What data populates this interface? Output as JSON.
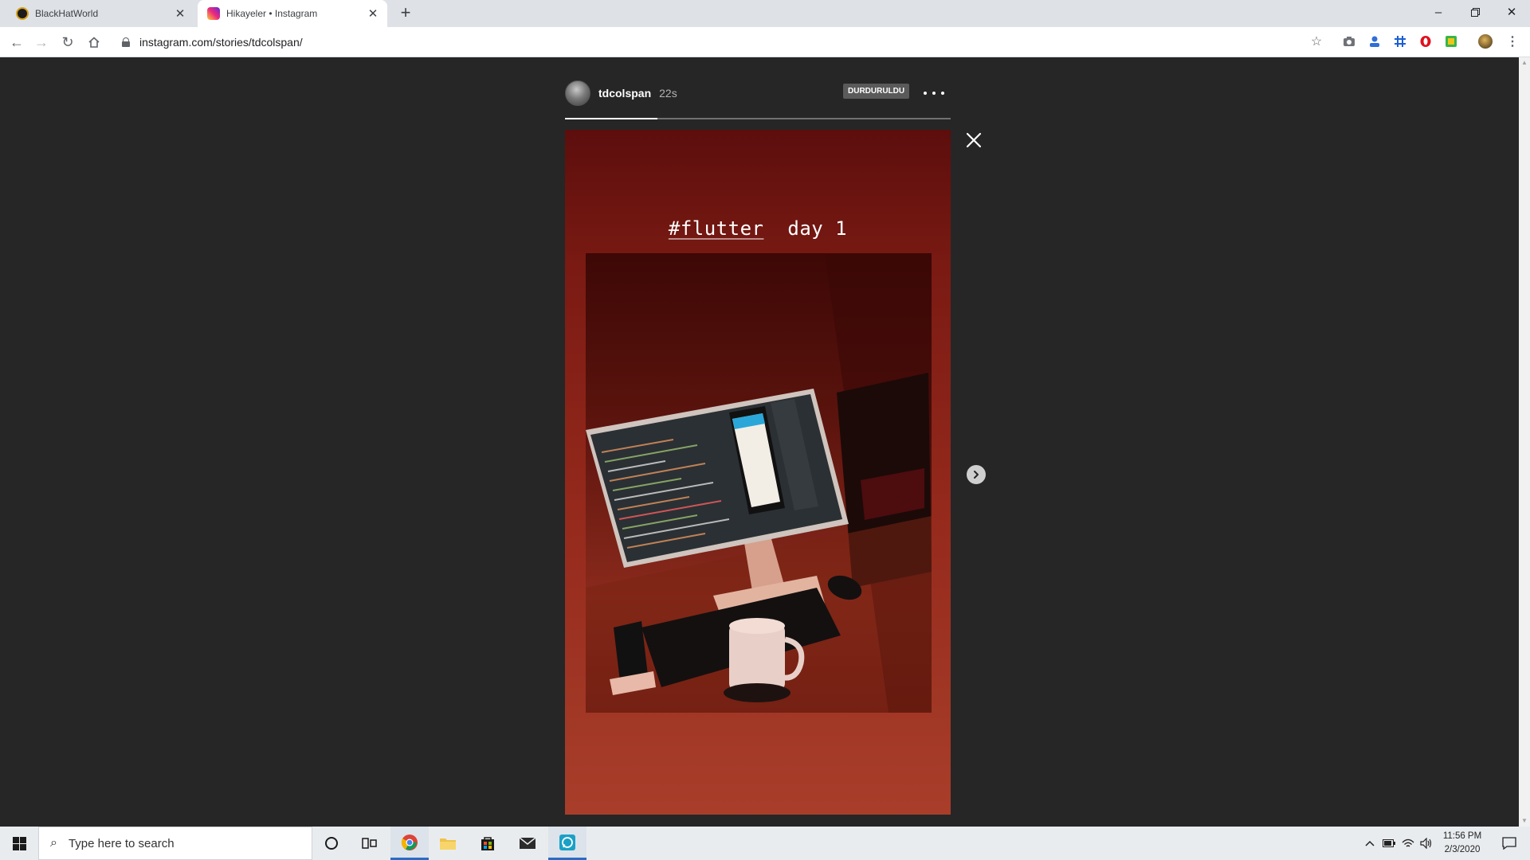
{
  "browser": {
    "tabs": [
      {
        "title": "BlackHatWorld",
        "favicon": "blackhatworld-logo",
        "active": false
      },
      {
        "title": "Hikayeler • Instagram",
        "favicon": "instagram-logo",
        "active": true
      }
    ],
    "new_tab_label": "+",
    "url": "instagram.com/stories/tdcolspan/"
  },
  "story": {
    "username": "tdcolspan",
    "timestamp": "22s",
    "paused_label": "DURDURULDU",
    "caption_hashtag": "#flutter",
    "caption_text": "day 1",
    "progress": 0.24
  },
  "taskbar": {
    "search_placeholder": "Type here to search",
    "time": "11:56 PM",
    "date": "2/3/2020"
  },
  "colors": {
    "viewer_background": "#262626",
    "story_red": "#94291c",
    "taskbar_bg": "#e9ecef",
    "tab_bar_bg": "#dee1e6"
  }
}
